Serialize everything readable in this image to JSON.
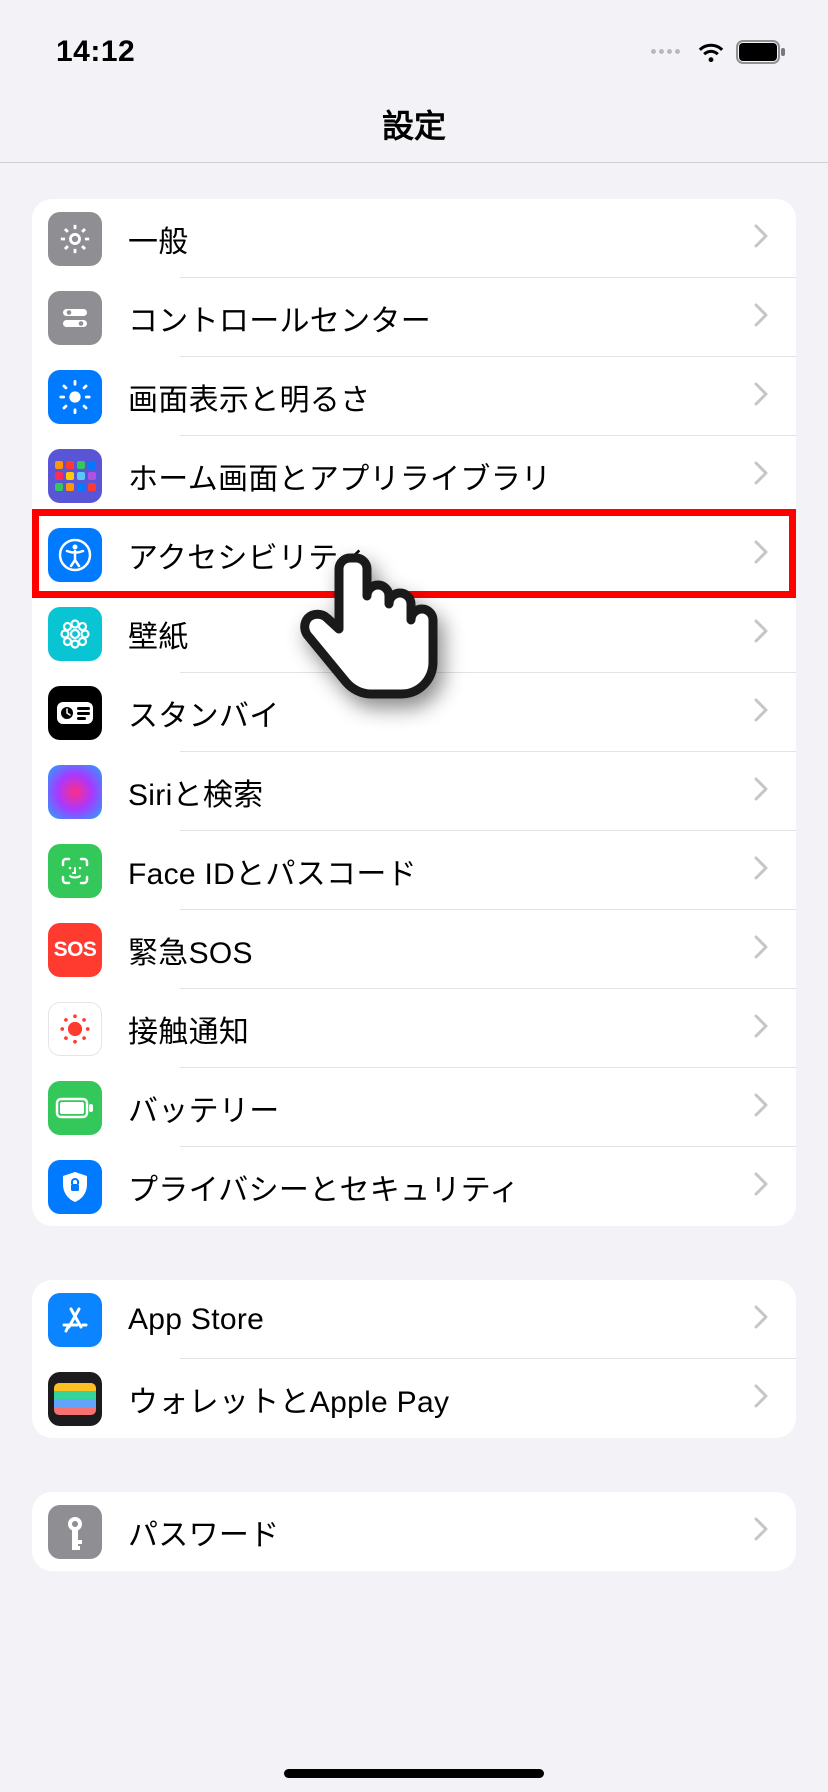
{
  "statusbar": {
    "time": "14:12"
  },
  "navbar": {
    "title": "設定"
  },
  "groups": [
    {
      "items": [
        {
          "key": "general",
          "label": "一般"
        },
        {
          "key": "control_center",
          "label": "コントロールセンター"
        },
        {
          "key": "display",
          "label": "画面表示と明るさ"
        },
        {
          "key": "home_screen",
          "label": "ホーム画面とアプリライブラリ"
        },
        {
          "key": "accessibility",
          "label": "アクセシビリティ"
        },
        {
          "key": "wallpaper",
          "label": "壁紙"
        },
        {
          "key": "standby",
          "label": "スタンバイ"
        },
        {
          "key": "siri",
          "label": "Siriと検索"
        },
        {
          "key": "faceid",
          "label": "Face IDとパスコード"
        },
        {
          "key": "sos",
          "label": "緊急SOS",
          "badge": "SOS"
        },
        {
          "key": "exposure",
          "label": "接触通知"
        },
        {
          "key": "battery",
          "label": "バッテリー"
        },
        {
          "key": "privacy",
          "label": "プライバシーとセキュリティ"
        }
      ]
    },
    {
      "items": [
        {
          "key": "appstore",
          "label": "App Store"
        },
        {
          "key": "wallet",
          "label": "ウォレットとApple Pay"
        }
      ]
    },
    {
      "items": [
        {
          "key": "passwords",
          "label": "パスワード"
        }
      ]
    }
  ],
  "highlight": {
    "target": "accessibility"
  }
}
